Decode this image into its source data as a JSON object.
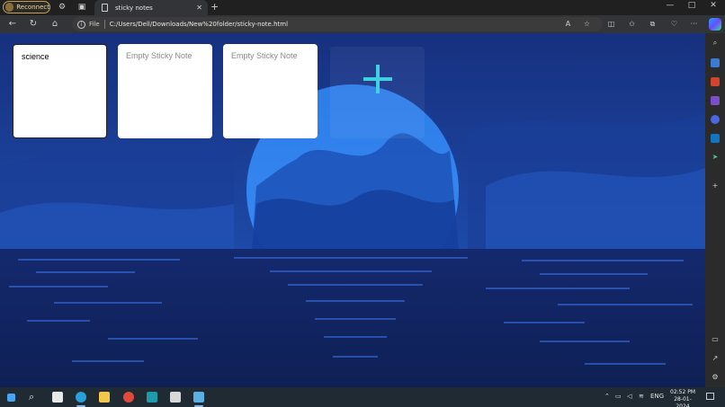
{
  "tabbar": {
    "reconnect_label": "Reconnect",
    "tab_title": "sticky notes",
    "tab_close": "✕",
    "new_tab": "+",
    "minimize": "—",
    "maximize": "□",
    "close": "✕"
  },
  "addressbar": {
    "back": "←",
    "refresh": "↻",
    "home": "⌂",
    "file_label": "File",
    "url": "C:/Users/Dell/Downloads/New%20folder/sticky-note.html",
    "more": "···"
  },
  "notes": [
    {
      "text": "science",
      "placeholder": false
    },
    {
      "text": "Empty Sticky Note",
      "placeholder": true
    },
    {
      "text": "Empty Sticky Note",
      "placeholder": true
    }
  ],
  "taskbar": {
    "lang": "ENG",
    "time": "02:52 PM",
    "date": "28-01-2024"
  },
  "colors": {
    "accent_plus": "#40d0e0",
    "background_deep": "#14307a",
    "moon": "#2f86f0"
  },
  "icons": {
    "sidebar": [
      "search-icon",
      "tag-icon",
      "briefcase-icon",
      "games-icon",
      "copilot-icon",
      "outlook-icon",
      "send-icon",
      "add-icon",
      "split-screen-icon",
      "external-icon",
      "settings-icon"
    ]
  }
}
